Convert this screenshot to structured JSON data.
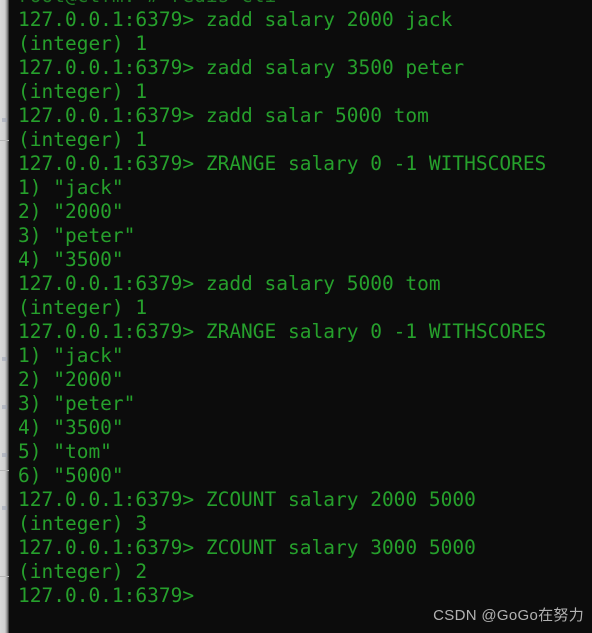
{
  "terminal": {
    "background_color": "#0c0c0c",
    "text_color": "#26a02c",
    "prompt": "127.0.0.1:6379>",
    "clipped_top_line": "root@ctfm:~# redis-cli",
    "lines": [
      "127.0.0.1:6379> zadd salary 2000 jack",
      "(integer) 1",
      "127.0.0.1:6379> zadd salary 3500 peter",
      "(integer) 1",
      "127.0.0.1:6379> zadd salar 5000 tom",
      "(integer) 1",
      "127.0.0.1:6379> ZRANGE salary 0 -1 WITHSCORES",
      "1) \"jack\"",
      "2) \"2000\"",
      "3) \"peter\"",
      "4) \"3500\"",
      "127.0.0.1:6379> zadd salary 5000 tom",
      "(integer) 1",
      "127.0.0.1:6379> ZRANGE salary 0 -1 WITHSCORES",
      "1) \"jack\"",
      "2) \"2000\"",
      "3) \"peter\"",
      "4) \"3500\"",
      "5) \"tom\"",
      "6) \"5000\"",
      "127.0.0.1:6379> ZCOUNT salary 2000 5000",
      "(integer) 3",
      "127.0.0.1:6379> ZCOUNT salary 3000 5000",
      "(integer) 2",
      "127.0.0.1:6379>"
    ]
  },
  "watermark": {
    "text": "CSDN @GoGo在努力",
    "color": "#cfcfcf"
  },
  "gutter": {
    "color": "#d0d0d0"
  }
}
